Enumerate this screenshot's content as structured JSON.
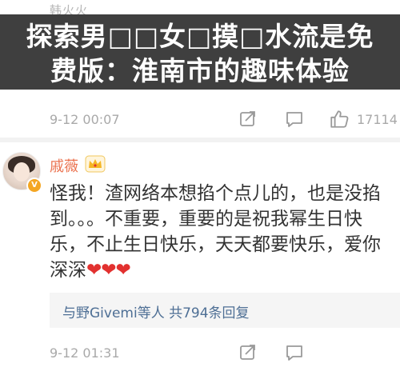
{
  "previous_comment": {
    "username": "韩火火"
  },
  "banner": {
    "line1": "探索男□□女□摸□水流是免",
    "line2": "费版：淮南市的趣味体验"
  },
  "row1": {
    "timestamp": "9-12 00:07",
    "like_count": "17114"
  },
  "comment": {
    "username": "戚薇",
    "text": "怪我！渣网络本想掐个点儿的，也是没掐到。。。不重要，重要的是祝我幂生日快乐，不止生日快乐，天天都要快乐，爱你深深",
    "hearts": "❤❤❤",
    "verified_badge": "V"
  },
  "replies": {
    "names": "与野Givemi等人",
    "summary": "共794条回复"
  },
  "row2": {
    "timestamp": "9-12 01:31"
  },
  "colors": {
    "username": "#eb7350",
    "link": "#4e6f95",
    "heart": "#e2312f",
    "banner_bg": "#3f3f3f"
  },
  "icons": {
    "share": "share-icon",
    "comment": "comment-icon",
    "like": "thumbs-up-icon",
    "crown": "crown-icon"
  }
}
